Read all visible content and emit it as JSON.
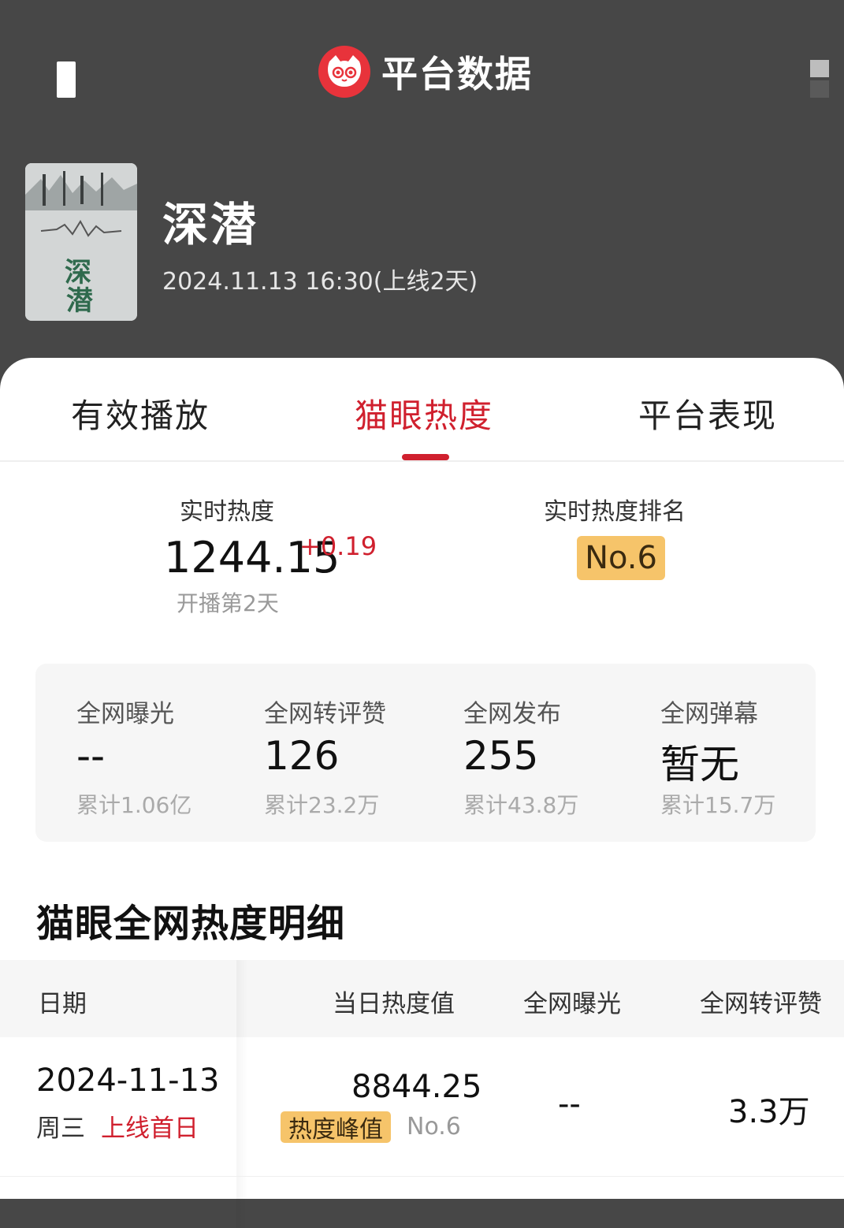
{
  "header": {
    "title": "平台数据"
  },
  "show": {
    "name": "深潜",
    "release": "2024.11.13 16:30(上线2天)"
  },
  "tabs": [
    {
      "label": "有效播放"
    },
    {
      "label": "猫眼热度"
    },
    {
      "label": "平台表现"
    }
  ],
  "realtime": {
    "heat_label": "实时热度",
    "heat_value": "1244.15",
    "heat_delta": "+0.19",
    "heat_sub": "开播第2天",
    "rank_label": "实时热度排名",
    "rank_value": "No.6"
  },
  "stats": [
    {
      "label": "全网曝光",
      "value": "--",
      "total": "累计1.06亿"
    },
    {
      "label": "全网转评赞",
      "value": "126",
      "total": "累计23.2万"
    },
    {
      "label": "全网发布",
      "value": "255",
      "total": "累计43.8万"
    },
    {
      "label": "全网弹幕",
      "value": "暂无",
      "total": "累计15.7万"
    }
  ],
  "detail": {
    "title": "猫眼全网热度明细",
    "columns": [
      "日期",
      "当日热度值",
      "全网曝光",
      "全网转评赞"
    ],
    "rows": [
      {
        "date": "2024-11-13",
        "weekday": "周三",
        "tag": "上线首日",
        "heat": "8844.25",
        "peak_label": "热度峰值",
        "peak_rank": "No.6",
        "exposure": "--",
        "engagement": "3.3万"
      }
    ]
  },
  "colors": {
    "header_bg": "#474747",
    "accent": "#d0202e",
    "badge": "#f6c46a"
  }
}
